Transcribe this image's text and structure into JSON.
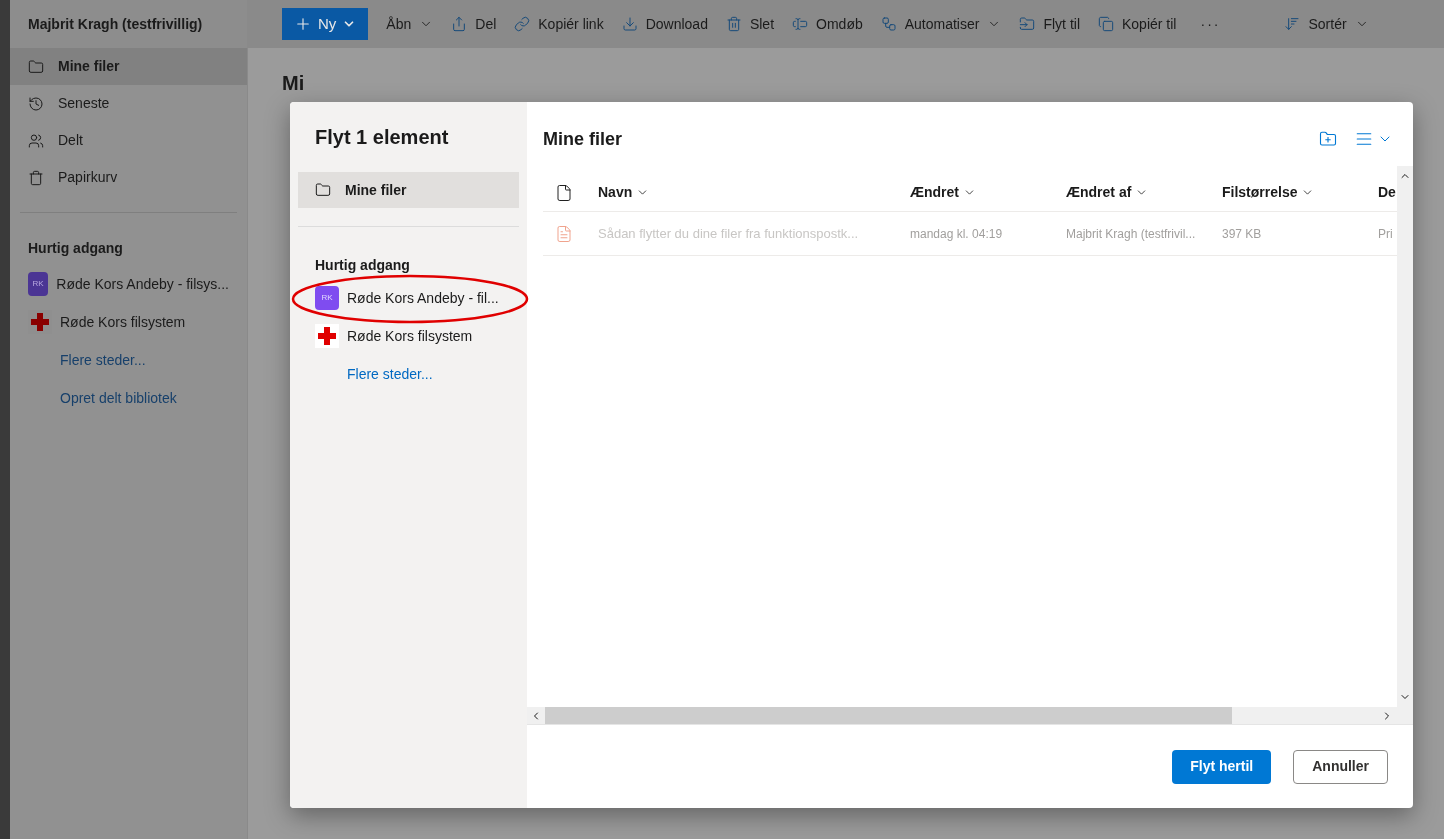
{
  "sidebar": {
    "account": "Majbrit Kragh (testfrivillig)",
    "items": [
      {
        "label": "Mine filer",
        "selected": true
      },
      {
        "label": "Seneste",
        "selected": false
      },
      {
        "label": "Delt",
        "selected": false
      },
      {
        "label": "Papirkurv",
        "selected": false
      }
    ],
    "quick_access": {
      "title": "Hurtig adgang",
      "items": [
        {
          "kind": "avatar",
          "initials": "RK",
          "label": "Røde Kors Andeby - filsys..."
        },
        {
          "kind": "logo",
          "label": "Røde Kors filsystem"
        },
        {
          "kind": "link",
          "label": "Flere steder..."
        },
        {
          "kind": "link",
          "label": "Opret delt bibliotek"
        }
      ]
    }
  },
  "toolbar": [
    {
      "kind": "primary",
      "label": "Ny",
      "chevron": true
    },
    {
      "kind": "action",
      "label": "Åbn",
      "chevron": true
    },
    {
      "kind": "action",
      "label": "Del",
      "chevron": false
    },
    {
      "kind": "action",
      "label": "Kopiér link",
      "chevron": false
    },
    {
      "kind": "action",
      "label": "Download",
      "chevron": false
    },
    {
      "kind": "action",
      "label": "Slet",
      "chevron": false
    },
    {
      "kind": "action",
      "label": "Omdøb",
      "chevron": false
    },
    {
      "kind": "action",
      "label": "Automatiser",
      "chevron": true
    },
    {
      "kind": "action",
      "label": "Flyt til",
      "chevron": false
    },
    {
      "kind": "action",
      "label": "Kopiér til",
      "chevron": false
    },
    {
      "kind": "more",
      "label": "···"
    },
    {
      "kind": "action",
      "label": "Sortér",
      "chevron": true
    }
  ],
  "page_heading": "Mi",
  "dialog": {
    "title": "Flyt 1 element",
    "nav": [
      {
        "label": "Mine filer",
        "selected": true
      }
    ],
    "quick_access": {
      "title": "Hurtig adgang",
      "items": [
        {
          "kind": "avatar",
          "initials": "RK",
          "label": "Røde Kors Andeby - fil..."
        },
        {
          "kind": "logo",
          "label": "Røde Kors filsystem"
        },
        {
          "kind": "link",
          "label": "Flere steder..."
        }
      ]
    },
    "folder_title": "Mine filer",
    "columns": [
      "Navn",
      "Ændret",
      "Ændret af",
      "Filstørrelse",
      "De"
    ],
    "rows": [
      {
        "disabled": true,
        "cells": [
          "Sådan flytter du dine filer fra funktionspostk...",
          "mandag kl. 04:19",
          "Majbrit Kragh (testfrivil...",
          "397 KB",
          "Pri"
        ]
      }
    ],
    "buttons": [
      {
        "kind": "primary",
        "label": "Flyt hertil"
      },
      {
        "kind": "secondary",
        "label": "Annuller"
      }
    ]
  }
}
